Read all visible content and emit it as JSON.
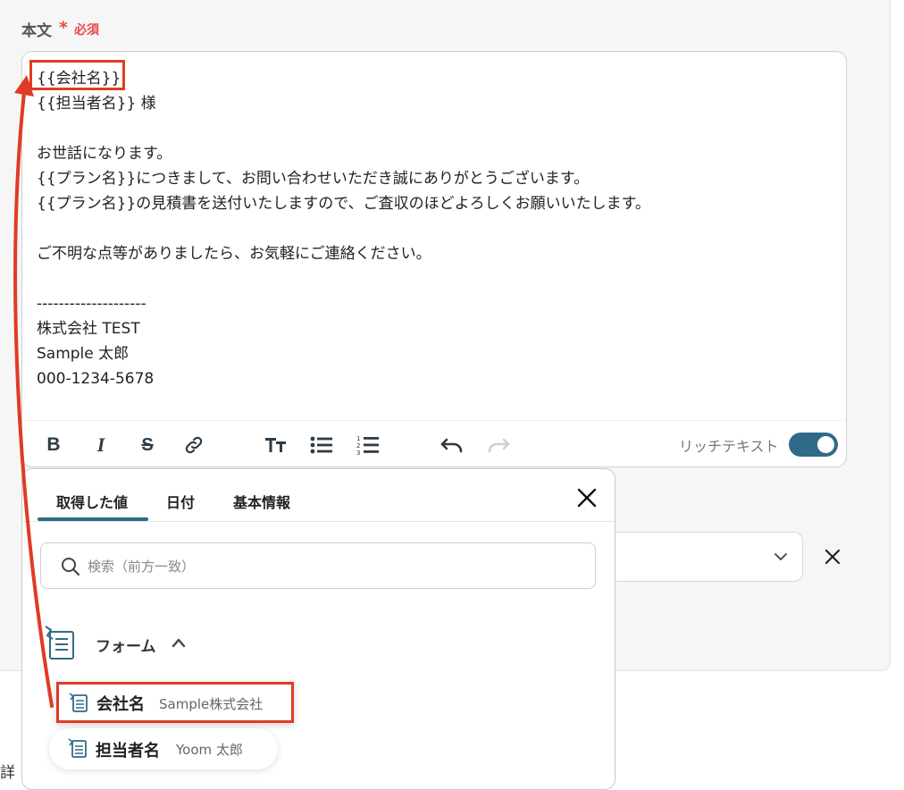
{
  "field": {
    "label": "本文",
    "required_mark": "*",
    "required_text": "必須"
  },
  "editor": {
    "lines": [
      "{{会社名}}",
      "{{担当者名}} 様",
      "",
      "お世話になります。",
      "{{プラン名}}につきまして、お問い合わせいただき誠にありがとうございます。",
      "{{プラン名}}の見積書を送付いたしますので、ご査収のほどよろしくお願いいたします。",
      "",
      "ご不明な点等がありましたら、お気軽にご連絡ください。",
      "",
      "--------------------",
      "株式会社 TEST",
      "Sample 太郎",
      "000-1234-5678"
    ],
    "rich_text_label": "リッチテキスト",
    "rich_text_enabled": true
  },
  "toolbar_icons": [
    "bold-icon",
    "italic-icon",
    "strikethrough-icon",
    "link-icon",
    "text-size-icon",
    "bullet-list-icon",
    "numbered-list-icon",
    "undo-icon",
    "redo-icon"
  ],
  "popup": {
    "tabs": [
      "取得した値",
      "日付",
      "基本情報"
    ],
    "active_tab": "取得した値",
    "search_placeholder": "検索（前方一致）",
    "group": {
      "label": "フォーム",
      "expanded": true
    },
    "items": [
      {
        "name": "会社名",
        "value": "Sample株式会社"
      },
      {
        "name": "担当者名",
        "value": "Yoom 太郎"
      }
    ]
  },
  "background": {
    "partial_text": "詳"
  },
  "colors": {
    "accent": "#2f6b86",
    "highlight": "#e03b24",
    "required": "#e5484d"
  }
}
